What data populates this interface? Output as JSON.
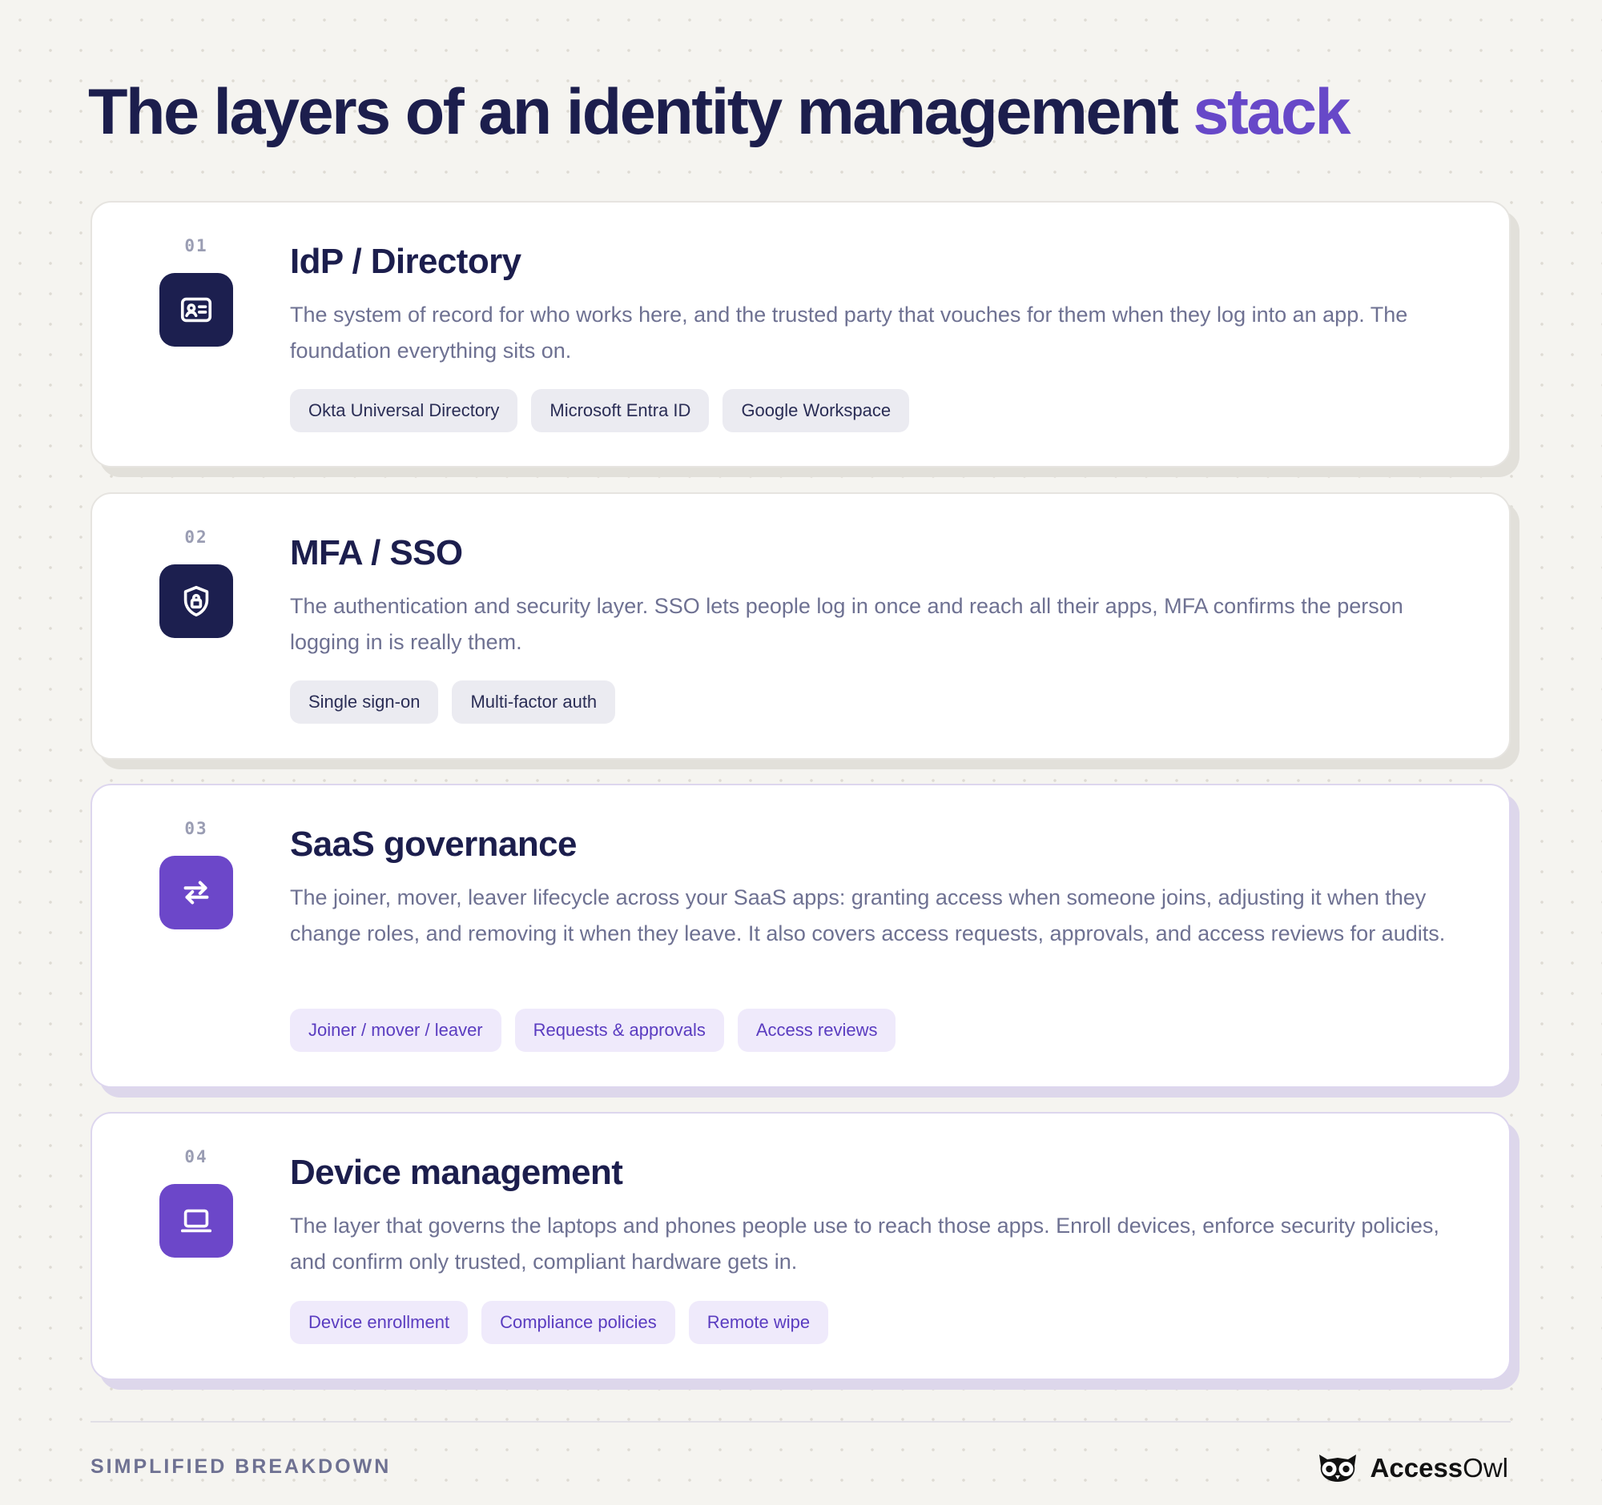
{
  "title": {
    "main": "The layers of an identity management",
    "accent": "stack"
  },
  "layers": [
    {
      "number": "01",
      "icon": "id-card-icon",
      "heading": "IdP / Directory",
      "description": "The system of record for who works here, and the trusted party that vouches for them when they log into an app. The foundation everything sits on.",
      "tags": [
        "Okta Universal Directory",
        "Microsoft Entra ID",
        "Google Workspace"
      ]
    },
    {
      "number": "02",
      "icon": "shield-lock-icon",
      "heading": "MFA / SSO",
      "description": "The authentication and security layer. SSO lets people log in once and reach all their apps, MFA confirms the person logging in is really them.",
      "tags": [
        "Single sign-on",
        "Multi-factor auth"
      ]
    },
    {
      "number": "03",
      "icon": "arrows-exchange-icon",
      "heading": "SaaS governance",
      "description": "The joiner, mover, leaver lifecycle across your SaaS apps: granting access when someone joins, adjusting it when they change roles, and removing it when they leave. It also covers access requests, approvals, and access reviews for audits.",
      "tags": [
        "Joiner / mover / leaver",
        "Requests & approvals",
        "Access reviews"
      ]
    },
    {
      "number": "04",
      "icon": "laptop-icon",
      "heading": "Device management",
      "description": "The layer that governs the laptops and phones people use to reach those apps. Enroll devices, enforce security policies, and confirm only trusted, compliant hardware gets in.",
      "tags": [
        "Device enrollment",
        "Compliance policies",
        "Remote wipe"
      ]
    }
  ],
  "footer": {
    "label": "SIMPLIFIED BREAKDOWN",
    "brand_bold": "Access",
    "brand_light": "Owl",
    "brand_icon": "owl-logo-icon"
  },
  "colors": {
    "background": "#f5f4f0",
    "navy": "#1c1e4d",
    "accent": "#6748c8",
    "icon_dark": "#1c1f4f",
    "icon_violet": "#6c47c9",
    "tag_gray": "#ebebf1",
    "tag_lavender": "#efeafb"
  }
}
